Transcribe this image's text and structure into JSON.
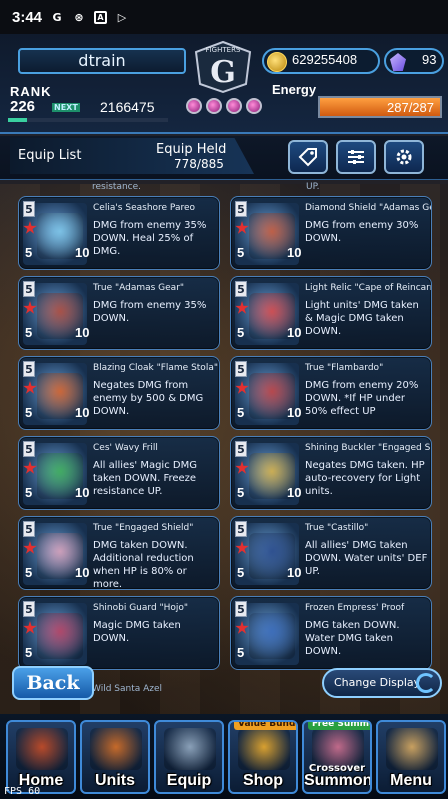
{
  "statusbar": {
    "time": "3:44",
    "icons": [
      "g-icon",
      "photos-icon",
      "a-icon",
      "play-store-icon"
    ]
  },
  "header": {
    "player_name": "dtrain",
    "gil": "629255408",
    "gems": "93",
    "rank_label": "RANK",
    "rank": "226",
    "next_label": "NEXT",
    "next_exp": "2166475",
    "energy_label": "Energy",
    "energy": "287/287",
    "logo_text": "FIGHTERS",
    "logo_letter": "G"
  },
  "toolbar": {
    "title": "Equip List",
    "held_label": "Equip Held",
    "held_value": "778/885",
    "buttons": [
      "tag-icon",
      "sort-icon",
      "gear-icon"
    ]
  },
  "partial_top": {
    "left": "resistance.",
    "right": "UP."
  },
  "cards": [
    {
      "name": "Celia's Seashore Pareo",
      "desc": "DMG from enemy 35% DOWN. Heal 25% of DMG.",
      "lvl": "5",
      "lvl2": "5",
      "count": "10",
      "color": "#7fc6e8"
    },
    {
      "name": "Diamond Shield \"Adamas Gear\"",
      "desc": "DMG from enemy 30% DOWN.",
      "lvl": "5",
      "lvl2": "5",
      "count": "10",
      "color": "#c85a3a"
    },
    {
      "name": "True \"Adamas Gear\"",
      "desc": "DMG from enemy 35% DOWN.",
      "lvl": "5",
      "lvl2": "5",
      "count": "10",
      "color": "#b04a3a"
    },
    {
      "name": "Light Relic \"Cape of Reincarnation\"",
      "desc": "Light units' DMG taken & Magic DMG taken DOWN.",
      "lvl": "5",
      "lvl2": "5",
      "count": "10",
      "color": "#d84848"
    },
    {
      "name": "Blazing Cloak \"Flame Stola\"",
      "desc": "Negates DMG from enemy by 500 & DMG DOWN.",
      "lvl": "5",
      "lvl2": "5",
      "count": "10",
      "color": "#d6622a"
    },
    {
      "name": "True \"Flambardo\"",
      "desc": "DMG from enemy 20% DOWN. *If HP under 50% effect UP",
      "lvl": "5",
      "lvl2": "5",
      "count": "10",
      "color": "#c04040"
    },
    {
      "name": "Ces' Wavy Frill",
      "desc": "All allies' Magic DMG taken DOWN. Freeze resistance UP.",
      "lvl": "5",
      "lvl2": "5",
      "count": "10",
      "color": "#3fae58"
    },
    {
      "name": "Shining Buckler \"Engaged Shield\"",
      "desc": "Negates DMG taken. HP auto-recovery for Light units.",
      "lvl": "5",
      "lvl2": "5",
      "count": "10",
      "color": "#d6b048"
    },
    {
      "name": "True \"Engaged Shield\"",
      "desc": "DMG taken DOWN. Additional reduction when HP is 80% or more.",
      "lvl": "5",
      "lvl2": "5",
      "count": "10",
      "color": "#d8a0b8"
    },
    {
      "name": "True \"Castillo\"",
      "desc": "All allies' DMG taken DOWN. Water units' DEF UP.",
      "lvl": "5",
      "lvl2": "5",
      "count": "10",
      "color": "#2a4a8a"
    },
    {
      "name": "Shinobi Guard \"Hojo\"",
      "desc": "Magic DMG taken DOWN.",
      "lvl": "5",
      "lvl2": "5",
      "count": "",
      "color": "#b84060"
    },
    {
      "name": "Frozen Empress' Proof",
      "desc": "DMG taken DOWN. Water DMG taken DOWN.",
      "lvl": "5",
      "lvl2": "5",
      "count": "",
      "color": "#3a6ab8"
    }
  ],
  "partial_bottom": {
    "left": "Wild Santa Azel",
    "right": ""
  },
  "back_label": "Back",
  "change_display_label": "Change Display",
  "nav": [
    {
      "label": "Home",
      "badge": "",
      "color": "#b84a2a"
    },
    {
      "label": "Units",
      "badge": "",
      "color": "#c66a2a"
    },
    {
      "label": "Equip",
      "badge": "",
      "color": "#8aa0b8"
    },
    {
      "label": "Shop",
      "badge": "Value Bundle",
      "color": "#d8a030"
    },
    {
      "label": "Summon",
      "badge": "Free Summon",
      "sub": "Crossover",
      "color": "#c06a8a"
    },
    {
      "label": "Menu",
      "badge": "",
      "color": "#c8a060"
    }
  ],
  "fps_label": "FPS",
  "fps_value": "60"
}
